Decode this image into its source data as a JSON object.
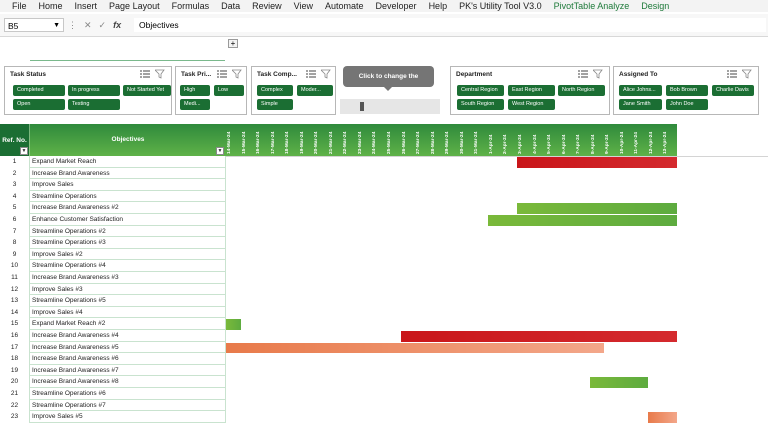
{
  "menu": [
    "File",
    "Home",
    "Insert",
    "Page Layout",
    "Formulas",
    "Data",
    "Review",
    "View",
    "Automate",
    "Developer",
    "Help",
    "PK's Utility Tool V3.0",
    "PivotTable Analyze",
    "Design"
  ],
  "menu_green": [
    "PivotTable Analyze",
    "Design"
  ],
  "formula_bar": {
    "name_box": "B5",
    "fx": "fx",
    "value": "Objectives"
  },
  "expand_button": "+",
  "slicers": {
    "task_status": {
      "title": "Task Status",
      "buttons": [
        "Completed",
        "In progress",
        "Not Started Yet",
        "Open",
        "Testing"
      ]
    },
    "task_priority": {
      "title": "Task Pri...",
      "buttons": [
        "High",
        "Low",
        "Medi..."
      ]
    },
    "task_complexity": {
      "title": "Task Comp...",
      "buttons": [
        "Complex",
        "Moder...",
        "Simple"
      ]
    },
    "department": {
      "title": "Department",
      "buttons": [
        "Central Region",
        "East Region",
        "North Region",
        "South Region",
        "West Region"
      ]
    },
    "assigned_to": {
      "title": "Assigned To",
      "buttons": [
        "Alice Johns...",
        "Bob Brown",
        "Charlie Davis",
        "Jane Smith",
        "John Doe"
      ]
    }
  },
  "timeline": {
    "label": "Click to change the"
  },
  "table": {
    "header_refno": "Ref. No.",
    "header_objectives": "Objectives",
    "dates": [
      "14-Mar-24",
      "15-Mar-24",
      "16-Mar-24",
      "17-Mar-24",
      "18-Mar-24",
      "19-Mar-24",
      "20-Mar-24",
      "21-Mar-24",
      "22-Mar-24",
      "23-Mar-24",
      "24-Mar-24",
      "25-Mar-24",
      "26-Mar-24",
      "27-Mar-24",
      "28-Mar-24",
      "29-Mar-24",
      "30-Mar-24",
      "31-Mar-24",
      "1-Apr-24",
      "2-Apr-24",
      "3-Apr-24",
      "4-Apr-24",
      "5-Apr-24",
      "6-Apr-24",
      "7-Apr-24",
      "8-Apr-24",
      "9-Apr-24",
      "10-Apr-24",
      "11-Apr-24",
      "12-Apr-24",
      "13-Apr-24"
    ],
    "rows": [
      {
        "n": "1",
        "obj": "Expand Market Reach"
      },
      {
        "n": "2",
        "obj": "Increase Brand Awareness"
      },
      {
        "n": "3",
        "obj": "Improve Sales"
      },
      {
        "n": "4",
        "obj": "Streamline Operations"
      },
      {
        "n": "5",
        "obj": "Increase Brand Awareness #2"
      },
      {
        "n": "6",
        "obj": "Enhance Customer Satisfaction"
      },
      {
        "n": "7",
        "obj": "Streamline Operations #2"
      },
      {
        "n": "8",
        "obj": "Streamline Operations #3"
      },
      {
        "n": "9",
        "obj": "Improve Sales #2"
      },
      {
        "n": "10",
        "obj": "Streamline Operations #4"
      },
      {
        "n": "11",
        "obj": "Increase Brand Awareness #3"
      },
      {
        "n": "12",
        "obj": "Improve Sales #3"
      },
      {
        "n": "13",
        "obj": "Streamline Operations #5"
      },
      {
        "n": "14",
        "obj": "Improve Sales #4"
      },
      {
        "n": "15",
        "obj": "Expand Market Reach #2"
      },
      {
        "n": "16",
        "obj": "Increase Brand Awareness #4"
      },
      {
        "n": "17",
        "obj": "Increase Brand Awareness #5"
      },
      {
        "n": "18",
        "obj": "Increase Brand Awareness #6"
      },
      {
        "n": "19",
        "obj": "Increase Brand Awareness #7"
      },
      {
        "n": "20",
        "obj": "Increase Brand Awareness #8"
      },
      {
        "n": "21",
        "obj": "Streamline Operations #6"
      },
      {
        "n": "22",
        "obj": "Streamline Operations #7"
      },
      {
        "n": "23",
        "obj": "Improve Sales #5"
      }
    ]
  },
  "gantt_bars": [
    {
      "row": 1,
      "start": "3-Apr-24",
      "end": "13-Apr-24",
      "color": "red"
    },
    {
      "row": 5,
      "start": "3-Apr-24",
      "end": "13-Apr-24",
      "color": "green"
    },
    {
      "row": 6,
      "start": "1-Apr-24",
      "end": "13-Apr-24",
      "color": "green"
    },
    {
      "row": 15,
      "start": "14-Mar-24",
      "end": "14-Mar-24",
      "color": "green"
    },
    {
      "row": 16,
      "start": "26-Mar-24",
      "end": "13-Apr-24",
      "color": "red"
    },
    {
      "row": 17,
      "start": "14-Mar-24",
      "end": "8-Apr-24",
      "color": "orange"
    },
    {
      "row": 20,
      "start": "8-Apr-24",
      "end": "11-Apr-24",
      "color": "green"
    },
    {
      "row": 23,
      "start": "12-Apr-24",
      "end": "13-Apr-24",
      "color": "orange"
    }
  ],
  "colors": {
    "header_green": "#1b6e33",
    "slicer_button": "#1b6e33",
    "bar_red": "#cc1a1e",
    "bar_green": "#6db33f",
    "bar_orange": "#ee8a5f"
  }
}
